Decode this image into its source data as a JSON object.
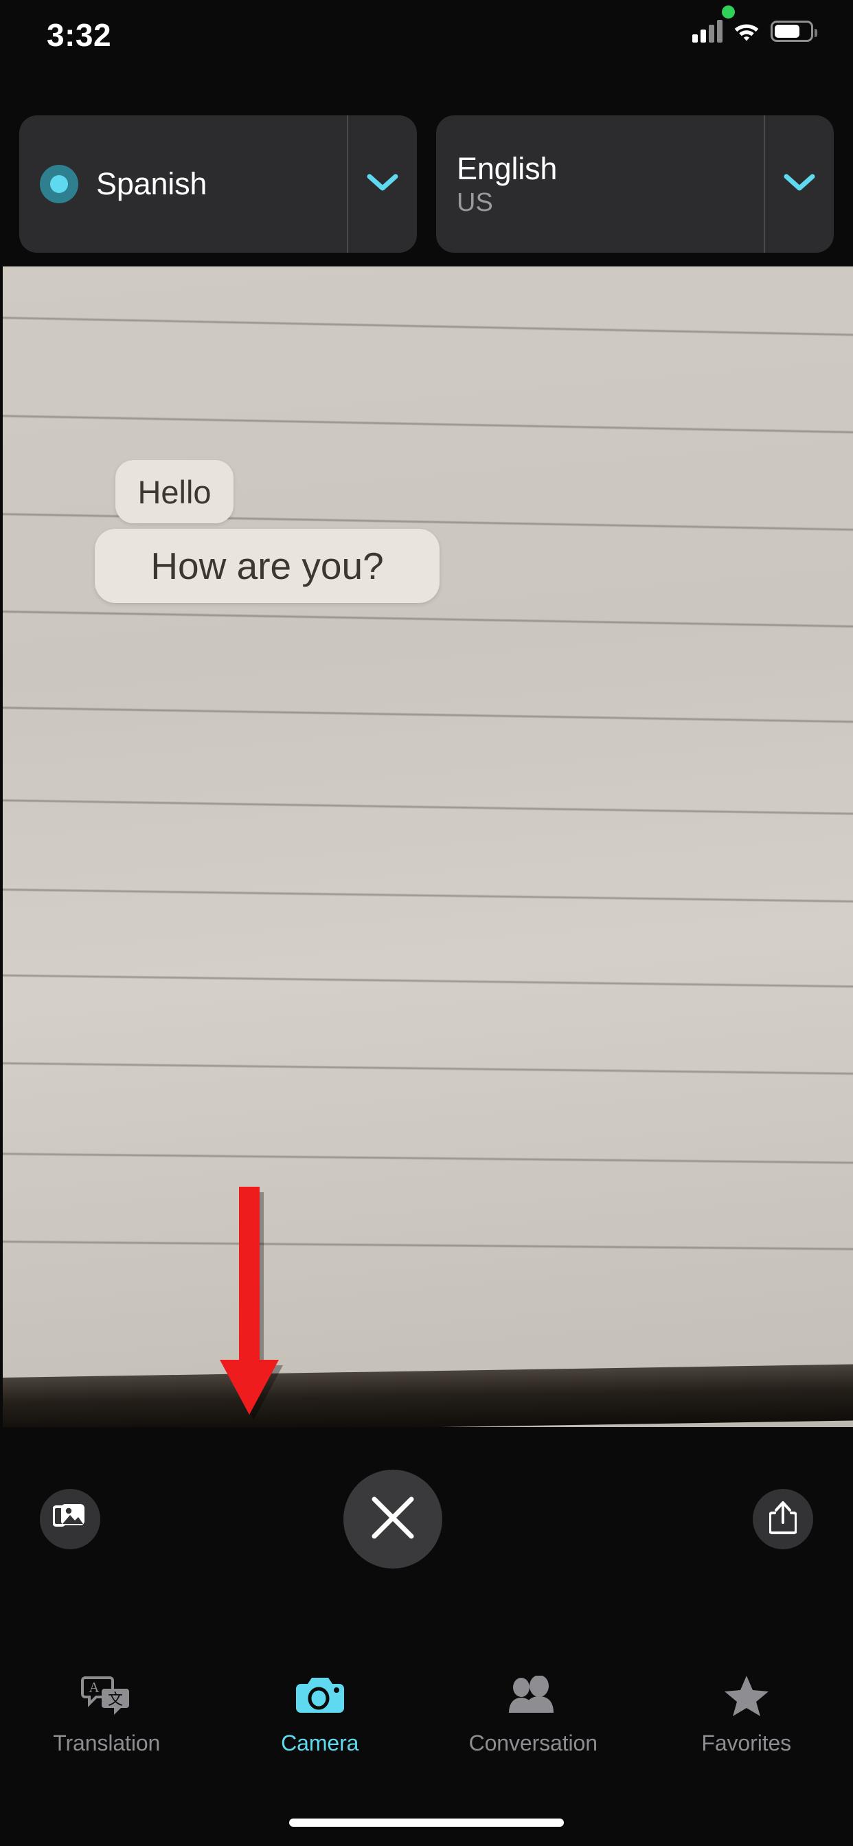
{
  "status_bar": {
    "time": "3:32",
    "recording_indicator": "green-dot",
    "cellular_icon": "cellular-bars-icon",
    "wifi_icon": "wifi-icon",
    "battery_icon": "battery-icon"
  },
  "language_bar": {
    "source": {
      "name": "Spanish",
      "sub": "",
      "listening_icon": "listening-dot-icon",
      "chevron_icon": "chevron-down-icon"
    },
    "target": {
      "name": "English",
      "sub": "US",
      "chevron_icon": "chevron-down-icon"
    }
  },
  "camera": {
    "detected_text": [
      {
        "text": "Hello"
      },
      {
        "text": "How are you?"
      }
    ],
    "annotation": {
      "type": "arrow-down",
      "color": "#ee1c1c",
      "points_to": "close-button"
    }
  },
  "controls": {
    "library_label": "Photo Library",
    "library_icon": "photo-library-icon",
    "close_label": "Close",
    "close_icon": "close-icon",
    "share_label": "Share",
    "share_icon": "share-icon"
  },
  "tabbar": {
    "active": "Camera",
    "accent_color": "#5ed9ef",
    "inactive_color": "#8d8d92",
    "items": [
      {
        "label": "Translation",
        "icon": "translation-bubbles-icon",
        "active": false
      },
      {
        "label": "Camera",
        "icon": "camera-icon",
        "active": true
      },
      {
        "label": "Conversation",
        "icon": "people-icon",
        "active": false
      },
      {
        "label": "Favorites",
        "icon": "star-icon",
        "active": false
      }
    ]
  },
  "home_indicator": "home-indicator"
}
